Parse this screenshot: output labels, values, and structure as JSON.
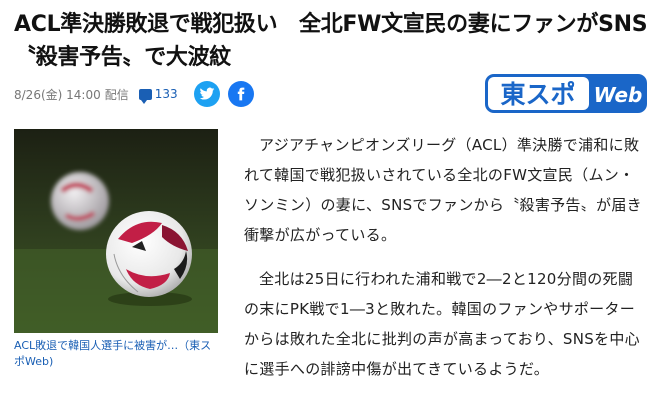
{
  "article": {
    "headline": "ACL準決勝敗退で戦犯扱い　全北FW文宣民の妻にファンがSNS〝殺害予告〟で大波紋",
    "meta": {
      "date": "8/26(金) 14:00",
      "distribution": "配信",
      "comment_count": "133"
    },
    "share": {
      "twitter_icon": "twitter-icon",
      "facebook_icon": "facebook-icon"
    },
    "source_logo": {
      "main": "東スポ",
      "sub": "Web"
    },
    "image": {
      "caption": "ACL敗退で韓国人選手に被害が…（東スポWeb)"
    },
    "paragraphs": [
      "アジアチャンピオンズリーグ（ACL）準決勝で浦和に敗れて韓国で戦犯扱いされている全北のFW文宣民（ムン・ソンミン）の妻に、SNSでファンから〝殺害予告〟が届き衝撃が広がっている。",
      "全北は25日に行われた浦和戦で2―2と120分間の死闘の末にPK戦で1―3と敗れた。韓国のファンやサポーターからは敗れた全北に批判の声が高まっており、SNSを中心に選手への誹謗中傷が出てきているようだ。"
    ]
  },
  "colors": {
    "link": "#1a5fb4",
    "twitter": "#1da1f2",
    "facebook": "#1877f2",
    "logo_blue": "#1a66c8"
  }
}
